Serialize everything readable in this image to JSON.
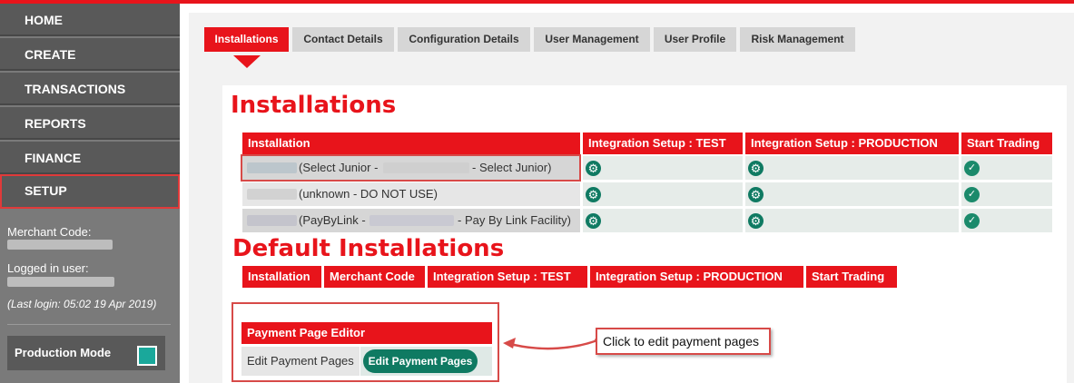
{
  "sidebar": {
    "items": [
      {
        "label": "HOME"
      },
      {
        "label": "CREATE"
      },
      {
        "label": "TRANSACTIONS"
      },
      {
        "label": "REPORTS"
      },
      {
        "label": "FINANCE"
      },
      {
        "label": "SETUP"
      }
    ],
    "merchant_code_label": "Merchant Code:",
    "logged_in_label": "Logged in user:",
    "last_login": "(Last login: 05:02 19 Apr 2019)",
    "production_mode_label": "Production Mode",
    "production_mode_color": "#1aa89b"
  },
  "tabs": [
    {
      "label": "Installations"
    },
    {
      "label": "Contact Details"
    },
    {
      "label": "Configuration Details"
    },
    {
      "label": "User Management"
    },
    {
      "label": "User Profile"
    },
    {
      "label": "Risk Management"
    }
  ],
  "installations": {
    "title": "Installations",
    "headers": [
      "Installation",
      "Integration Setup : TEST",
      "Integration Setup : PRODUCTION",
      "Start Trading"
    ],
    "rows": [
      {
        "name": "(Select Junior -",
        "name_suffix": "- Select Junior)"
      },
      {
        "name": "(unknown - DO NOT USE)",
        "name_suffix": ""
      },
      {
        "name": "(PayByLink -",
        "name_suffix": "- Pay By Link Facility)"
      }
    ]
  },
  "default_installations": {
    "title": "Default Installations",
    "headers": [
      "Installation",
      "Merchant Code",
      "Integration Setup : TEST",
      "Integration Setup : PRODUCTION",
      "Start Trading"
    ]
  },
  "payment_page_editor": {
    "header": "Payment Page Editor",
    "label": "Edit Payment Pages",
    "button_label": "Edit Payment Pages"
  },
  "callout": {
    "text": "Click to edit payment pages"
  },
  "colors": {
    "accent": "#e8141b",
    "action_green": "#0f7a62"
  }
}
